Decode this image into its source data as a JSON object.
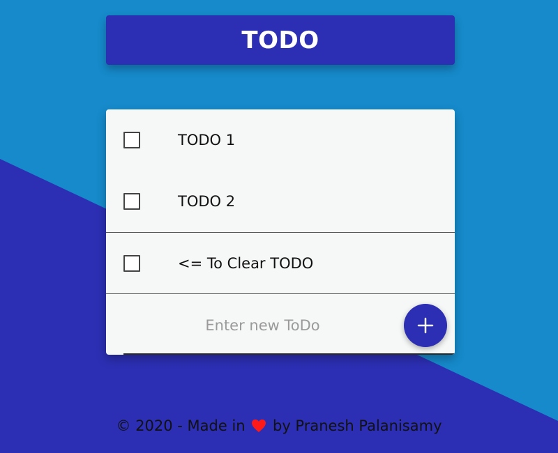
{
  "header": {
    "title": "TODO"
  },
  "todos": [
    {
      "label": "TODO 1",
      "checked": false
    },
    {
      "label": "TODO 2",
      "checked": false
    },
    {
      "label": "<= To Clear TODO",
      "checked": false
    }
  ],
  "new_todo": {
    "placeholder": "Enter new ToDo",
    "value": ""
  },
  "add_button": {
    "icon": "plus-icon"
  },
  "footer": {
    "before_heart": "© 2020 - Made in",
    "heart_icon": "heart-icon",
    "after_heart": "by Pranesh Palanisamy"
  },
  "colors": {
    "background_light": "#168acb",
    "background_dark": "#2c2fb3",
    "accent": "#2c2fb3",
    "card": "#f6f8f7",
    "heart": "#ff1a1a"
  }
}
